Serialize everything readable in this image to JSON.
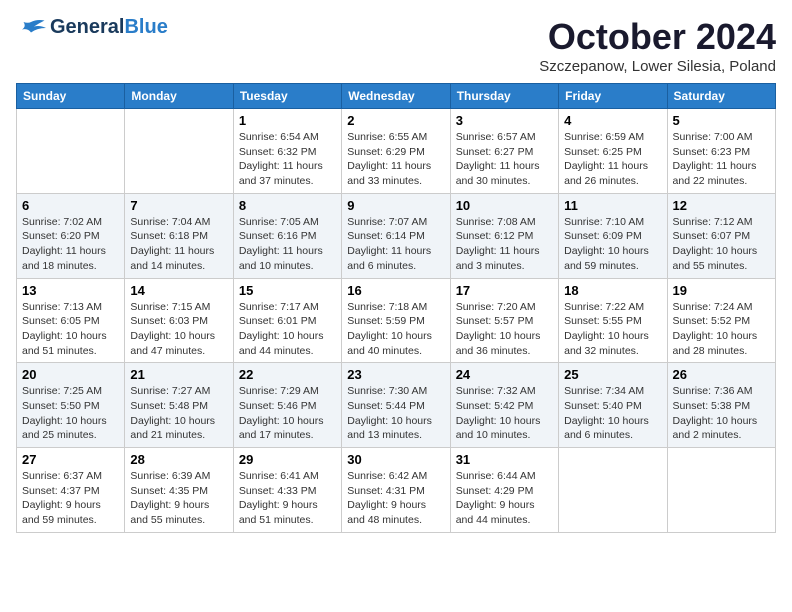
{
  "logo": {
    "text_general": "General",
    "text_blue": "Blue"
  },
  "title": "October 2024",
  "subtitle": "Szczepanow, Lower Silesia, Poland",
  "days_of_week": [
    "Sunday",
    "Monday",
    "Tuesday",
    "Wednesday",
    "Thursday",
    "Friday",
    "Saturday"
  ],
  "weeks": [
    [
      {
        "day": "",
        "info": ""
      },
      {
        "day": "",
        "info": ""
      },
      {
        "day": "1",
        "info": "Sunrise: 6:54 AM\nSunset: 6:32 PM\nDaylight: 11 hours\nand 37 minutes."
      },
      {
        "day": "2",
        "info": "Sunrise: 6:55 AM\nSunset: 6:29 PM\nDaylight: 11 hours\nand 33 minutes."
      },
      {
        "day": "3",
        "info": "Sunrise: 6:57 AM\nSunset: 6:27 PM\nDaylight: 11 hours\nand 30 minutes."
      },
      {
        "day": "4",
        "info": "Sunrise: 6:59 AM\nSunset: 6:25 PM\nDaylight: 11 hours\nand 26 minutes."
      },
      {
        "day": "5",
        "info": "Sunrise: 7:00 AM\nSunset: 6:23 PM\nDaylight: 11 hours\nand 22 minutes."
      }
    ],
    [
      {
        "day": "6",
        "info": "Sunrise: 7:02 AM\nSunset: 6:20 PM\nDaylight: 11 hours\nand 18 minutes."
      },
      {
        "day": "7",
        "info": "Sunrise: 7:04 AM\nSunset: 6:18 PM\nDaylight: 11 hours\nand 14 minutes."
      },
      {
        "day": "8",
        "info": "Sunrise: 7:05 AM\nSunset: 6:16 PM\nDaylight: 11 hours\nand 10 minutes."
      },
      {
        "day": "9",
        "info": "Sunrise: 7:07 AM\nSunset: 6:14 PM\nDaylight: 11 hours\nand 6 minutes."
      },
      {
        "day": "10",
        "info": "Sunrise: 7:08 AM\nSunset: 6:12 PM\nDaylight: 11 hours\nand 3 minutes."
      },
      {
        "day": "11",
        "info": "Sunrise: 7:10 AM\nSunset: 6:09 PM\nDaylight: 10 hours\nand 59 minutes."
      },
      {
        "day": "12",
        "info": "Sunrise: 7:12 AM\nSunset: 6:07 PM\nDaylight: 10 hours\nand 55 minutes."
      }
    ],
    [
      {
        "day": "13",
        "info": "Sunrise: 7:13 AM\nSunset: 6:05 PM\nDaylight: 10 hours\nand 51 minutes."
      },
      {
        "day": "14",
        "info": "Sunrise: 7:15 AM\nSunset: 6:03 PM\nDaylight: 10 hours\nand 47 minutes."
      },
      {
        "day": "15",
        "info": "Sunrise: 7:17 AM\nSunset: 6:01 PM\nDaylight: 10 hours\nand 44 minutes."
      },
      {
        "day": "16",
        "info": "Sunrise: 7:18 AM\nSunset: 5:59 PM\nDaylight: 10 hours\nand 40 minutes."
      },
      {
        "day": "17",
        "info": "Sunrise: 7:20 AM\nSunset: 5:57 PM\nDaylight: 10 hours\nand 36 minutes."
      },
      {
        "day": "18",
        "info": "Sunrise: 7:22 AM\nSunset: 5:55 PM\nDaylight: 10 hours\nand 32 minutes."
      },
      {
        "day": "19",
        "info": "Sunrise: 7:24 AM\nSunset: 5:52 PM\nDaylight: 10 hours\nand 28 minutes."
      }
    ],
    [
      {
        "day": "20",
        "info": "Sunrise: 7:25 AM\nSunset: 5:50 PM\nDaylight: 10 hours\nand 25 minutes."
      },
      {
        "day": "21",
        "info": "Sunrise: 7:27 AM\nSunset: 5:48 PM\nDaylight: 10 hours\nand 21 minutes."
      },
      {
        "day": "22",
        "info": "Sunrise: 7:29 AM\nSunset: 5:46 PM\nDaylight: 10 hours\nand 17 minutes."
      },
      {
        "day": "23",
        "info": "Sunrise: 7:30 AM\nSunset: 5:44 PM\nDaylight: 10 hours\nand 13 minutes."
      },
      {
        "day": "24",
        "info": "Sunrise: 7:32 AM\nSunset: 5:42 PM\nDaylight: 10 hours\nand 10 minutes."
      },
      {
        "day": "25",
        "info": "Sunrise: 7:34 AM\nSunset: 5:40 PM\nDaylight: 10 hours\nand 6 minutes."
      },
      {
        "day": "26",
        "info": "Sunrise: 7:36 AM\nSunset: 5:38 PM\nDaylight: 10 hours\nand 2 minutes."
      }
    ],
    [
      {
        "day": "27",
        "info": "Sunrise: 6:37 AM\nSunset: 4:37 PM\nDaylight: 9 hours\nand 59 minutes."
      },
      {
        "day": "28",
        "info": "Sunrise: 6:39 AM\nSunset: 4:35 PM\nDaylight: 9 hours\nand 55 minutes."
      },
      {
        "day": "29",
        "info": "Sunrise: 6:41 AM\nSunset: 4:33 PM\nDaylight: 9 hours\nand 51 minutes."
      },
      {
        "day": "30",
        "info": "Sunrise: 6:42 AM\nSunset: 4:31 PM\nDaylight: 9 hours\nand 48 minutes."
      },
      {
        "day": "31",
        "info": "Sunrise: 6:44 AM\nSunset: 4:29 PM\nDaylight: 9 hours\nand 44 minutes."
      },
      {
        "day": "",
        "info": ""
      },
      {
        "day": "",
        "info": ""
      }
    ]
  ]
}
